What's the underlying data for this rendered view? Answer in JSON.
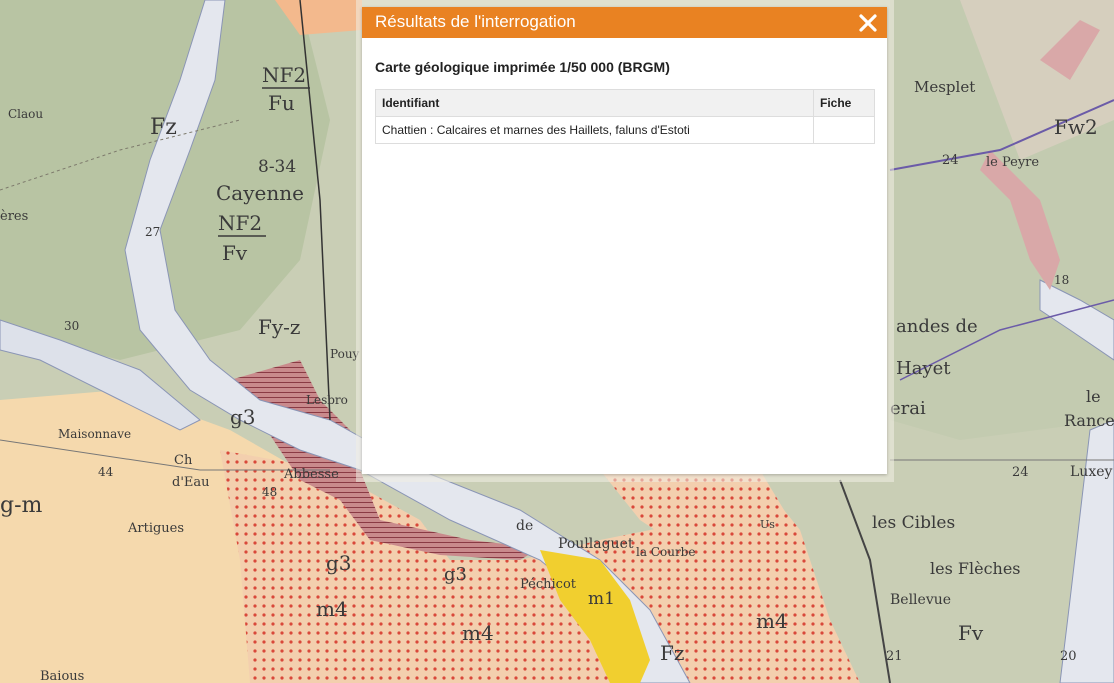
{
  "popup": {
    "title": "Résultats de l'interrogation",
    "close_icon": "close-icon",
    "layer_title": "Carte géologique imprimée 1/50 000 (BRGM)",
    "table": {
      "columns": [
        "Identifiant",
        "Fiche"
      ],
      "rows": [
        {
          "identifiant": "Chattien : Calcaires et marnes des Haillets, faluns d'Estoti",
          "fiche": ""
        }
      ]
    }
  },
  "colors": {
    "header": "#e98222",
    "map_background": "#d8d6c4"
  },
  "map": {
    "labels": {
      "claou": "Claou",
      "fz": "Fz",
      "nf2": "NF2",
      "fu": "Fu",
      "num_834": "8-34",
      "cayenne": "Cayenne",
      "nf2b": "NF2",
      "fv": "Fv",
      "num_27": "27",
      "eres": "ères",
      "num_30": "30",
      "fyz": "Fy-z",
      "pou": "Pouy",
      "g3a": "g3",
      "lesbro": "Lesbro",
      "maisonnave": "Maisonnave",
      "ch": "Ch",
      "abbesse": "Abbesse",
      "deau": "d'Eau",
      "num_44": "44",
      "num_48": "48",
      "gm": "g-m",
      "artigues": "Artigues",
      "g3b": "g3",
      "g3c": "g3",
      "m4a": "m4",
      "m4b": "m4",
      "pechicot": "Péchicot",
      "m1": "m1",
      "fz2": "Fz",
      "baious": "Baious",
      "de": "de",
      "poullaquet": "Poullaguet",
      "lacourbe": "la Courbe",
      "mesplet": "Mesplet",
      "fw2": "Fw2",
      "num_24a": "24",
      "lepeyre": "le Peyre",
      "num_18": "18",
      "landesde": "andes de",
      "hayet": "Hayet",
      "erai": "erai",
      "le": "le",
      "rance": "Rance",
      "num_24b": "24",
      "luxey": "Luxey",
      "lescibles": "les Cibles",
      "lesfleches": "les Flèches",
      "bellevue": "Bellevue",
      "m4c": "m4",
      "fv2": "Fv",
      "num_21": "21",
      "num_20": "20",
      "us": "Us"
    }
  }
}
